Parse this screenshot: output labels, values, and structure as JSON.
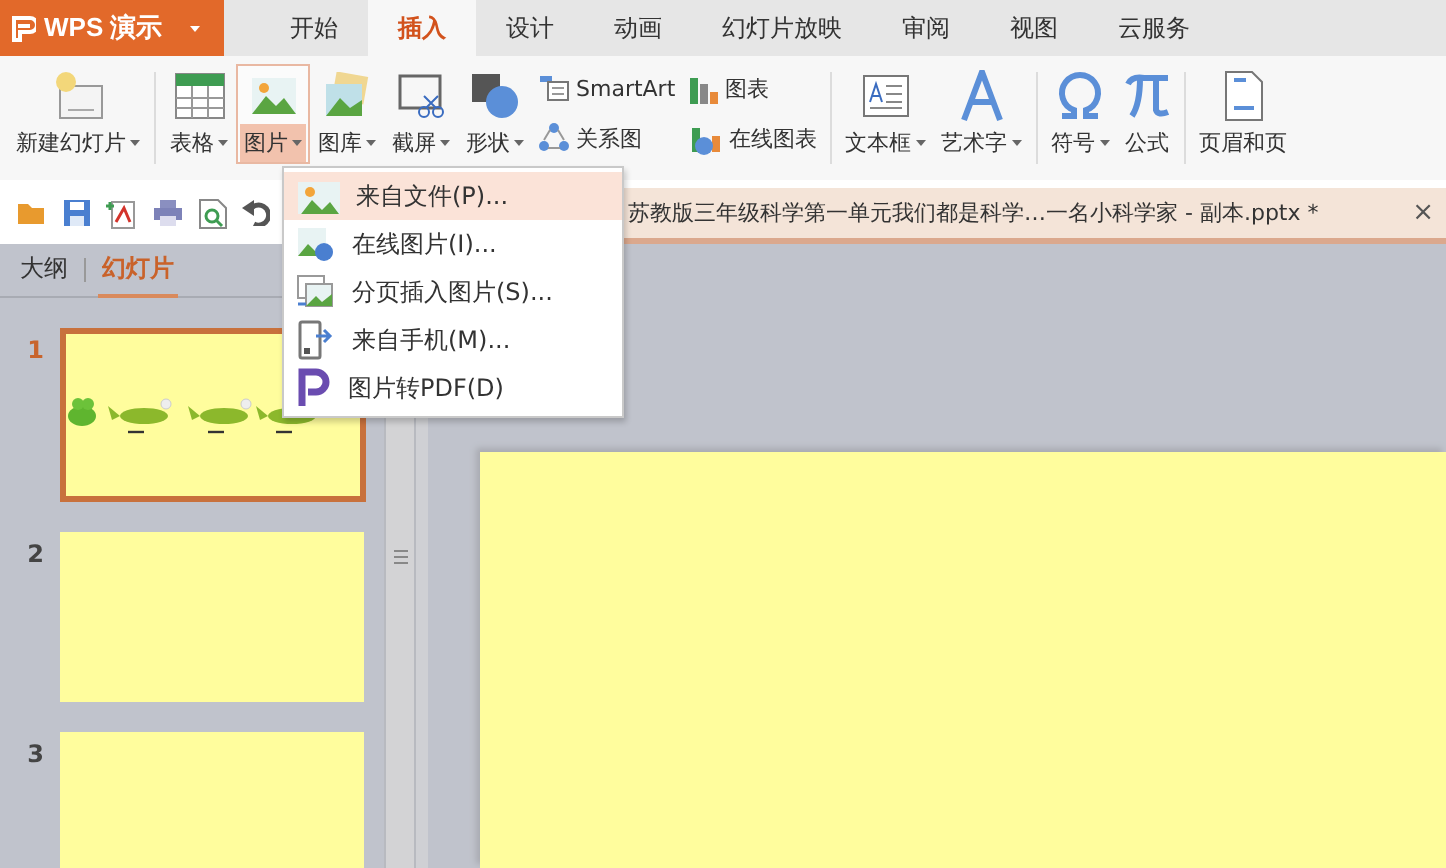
{
  "app": {
    "name": "WPS 演示"
  },
  "tabs": [
    {
      "label": "开始",
      "selected": false
    },
    {
      "label": "插入",
      "selected": true
    },
    {
      "label": "设计",
      "selected": false
    },
    {
      "label": "动画",
      "selected": false
    },
    {
      "label": "幻灯片放映",
      "selected": false
    },
    {
      "label": "审阅",
      "selected": false
    },
    {
      "label": "视图",
      "selected": false
    },
    {
      "label": "云服务",
      "selected": false
    }
  ],
  "ribbon": [
    {
      "kind": "big",
      "label": "新建幻灯片",
      "dropdown": true,
      "selected": false
    },
    {
      "kind": "divider"
    },
    {
      "kind": "big",
      "label": "表格",
      "dropdown": true,
      "selected": false
    },
    {
      "kind": "big",
      "label": "图片",
      "dropdown": true,
      "selected": true
    },
    {
      "kind": "big",
      "label": "图库",
      "dropdown": true,
      "selected": false
    },
    {
      "kind": "big",
      "label": "截屏",
      "dropdown": true,
      "selected": false
    },
    {
      "kind": "big",
      "label": "形状",
      "dropdown": true,
      "selected": false
    },
    {
      "kind": "small",
      "items": [
        {
          "label": "SmartArt"
        },
        {
          "label": "关系图"
        }
      ]
    },
    {
      "kind": "small",
      "items": [
        {
          "label": "图表"
        },
        {
          "label": "在线图表"
        }
      ]
    },
    {
      "kind": "divider"
    },
    {
      "kind": "big",
      "label": "文本框",
      "dropdown": true,
      "selected": false
    },
    {
      "kind": "big",
      "label": "艺术字",
      "dropdown": true,
      "selected": false
    },
    {
      "kind": "divider"
    },
    {
      "kind": "big",
      "label": "符号",
      "dropdown": true,
      "selected": false
    },
    {
      "kind": "big",
      "label": "公式",
      "dropdown": false,
      "selected": false
    },
    {
      "kind": "divider"
    },
    {
      "kind": "big",
      "label": "页眉和页",
      "dropdown": false,
      "selected": false
    }
  ],
  "document_tab": {
    "title": "苏教版三年级科学第一单元我们都是科学…一名小科学家 - 副本.pptx *",
    "close": "×"
  },
  "picture_menu": [
    {
      "label": "来自文件(P)...",
      "selected": true
    },
    {
      "label": "在线图片(I)...",
      "selected": false
    },
    {
      "label": "分页插入图片(S)...",
      "selected": false
    },
    {
      "label": "来自手机(M)...",
      "selected": false
    },
    {
      "label": "图片转PDF(D)",
      "selected": false
    }
  ],
  "panel_tabs": [
    {
      "label": "大纲",
      "selected": false
    },
    {
      "label": "幻灯片",
      "selected": true
    }
  ],
  "slides": [
    {
      "number": "1",
      "selected": true,
      "kind": "illustrated"
    },
    {
      "number": "2",
      "selected": false,
      "kind": "blank"
    },
    {
      "number": "3",
      "selected": false,
      "kind": "blank"
    }
  ]
}
